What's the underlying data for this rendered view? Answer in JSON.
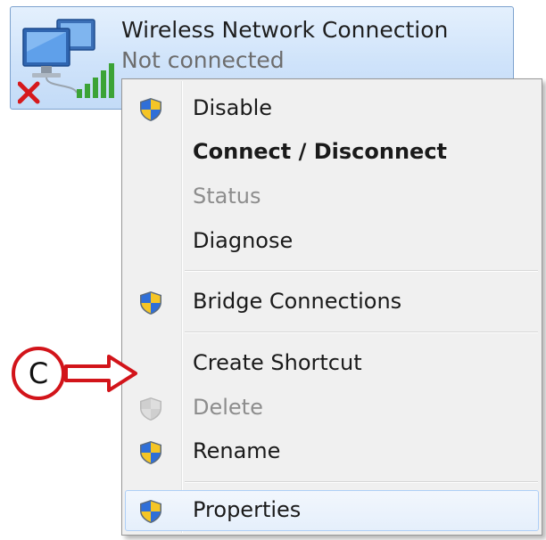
{
  "connection": {
    "name": "Wireless Network Connection",
    "status": "Not connected",
    "icon": "wireless-network-disconnected-icon"
  },
  "menu": {
    "items": [
      {
        "label": "Disable",
        "shield": true,
        "bold": false,
        "disabled": false
      },
      {
        "label": "Connect / Disconnect",
        "shield": false,
        "bold": true,
        "disabled": false
      },
      {
        "label": "Status",
        "shield": false,
        "bold": false,
        "disabled": true
      },
      {
        "label": "Diagnose",
        "shield": false,
        "bold": false,
        "disabled": false
      },
      {
        "label": "Bridge Connections",
        "shield": true,
        "bold": false,
        "disabled": false
      },
      {
        "label": "Create Shortcut",
        "shield": false,
        "bold": false,
        "disabled": false
      },
      {
        "label": "Delete",
        "shield": true,
        "bold": false,
        "disabled": true
      },
      {
        "label": "Rename",
        "shield": true,
        "bold": false,
        "disabled": false
      },
      {
        "label": "Properties",
        "shield": true,
        "bold": false,
        "disabled": false,
        "highlighted": true
      }
    ]
  },
  "annotation": {
    "label": "C",
    "color": "#d2141a"
  },
  "colors": {
    "tile_border": "#7da2ce",
    "hover_border": "#aecff7",
    "disabled_text": "#8d8d8d"
  }
}
